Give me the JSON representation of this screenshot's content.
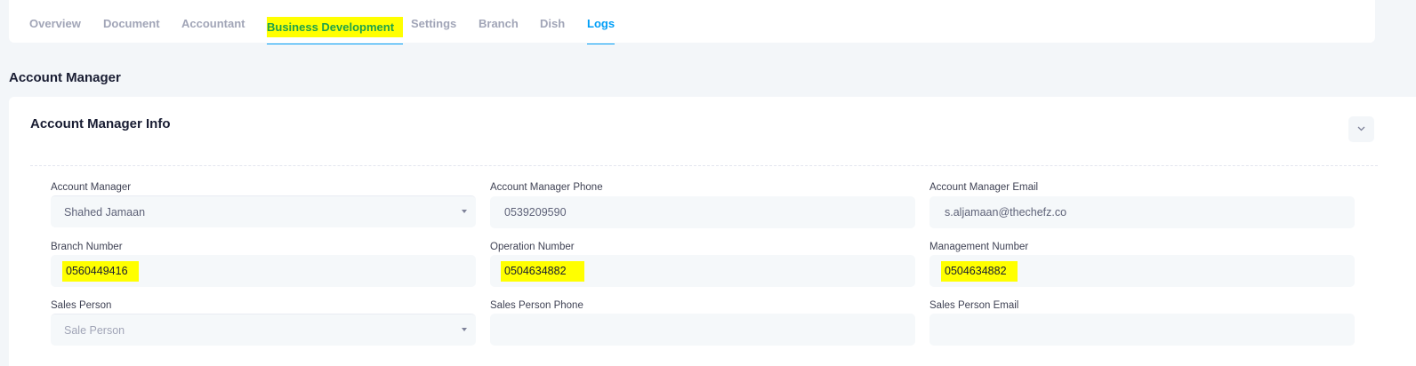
{
  "tabs": [
    {
      "label": "Overview"
    },
    {
      "label": "Document"
    },
    {
      "label": "Accountant"
    },
    {
      "label": "Business Development"
    },
    {
      "label": "Settings"
    },
    {
      "label": "Branch"
    },
    {
      "label": "Dish"
    },
    {
      "label": "Logs"
    }
  ],
  "active_tab": "Business Development",
  "section": {
    "title": "Account Manager"
  },
  "card": {
    "title": "Account Manager Info",
    "collapse_icon": "chevron-down-icon"
  },
  "fields": {
    "account_manager": {
      "label": "Account Manager",
      "value": "Shahed Jamaan"
    },
    "account_manager_phone": {
      "label": "Account Manager Phone",
      "value": "0539209590"
    },
    "account_manager_email": {
      "label": "Account Manager Email",
      "value": "s.aljamaan@thechefz.co"
    },
    "branch_number": {
      "label": "Branch Number",
      "value": "0560449416"
    },
    "operation_number": {
      "label": "Operation Number",
      "value": "0504634882"
    },
    "management_number": {
      "label": "Management Number",
      "value": "0504634882"
    },
    "sales_person": {
      "label": "Sales Person",
      "placeholder": "Sale Person"
    },
    "sales_person_phone": {
      "label": "Sales Person Phone",
      "value": ""
    },
    "sales_person_email": {
      "label": "Sales Person Email",
      "value": ""
    }
  },
  "colors": {
    "accent": "#009ef7",
    "highlight": "#ffff00",
    "highlight_text": "#1ea34a",
    "background": "#f3f6f9"
  }
}
